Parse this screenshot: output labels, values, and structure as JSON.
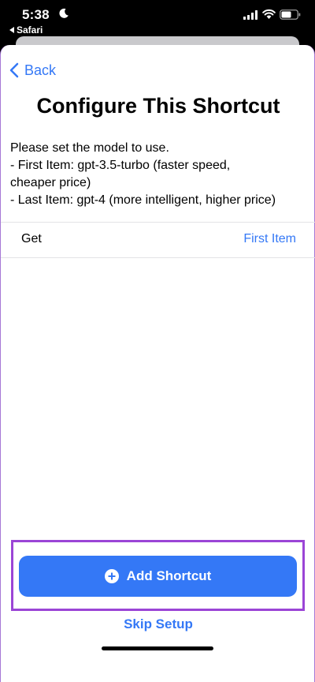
{
  "status": {
    "time": "5:38",
    "back_app": "Safari"
  },
  "nav": {
    "back_label": "Back"
  },
  "page": {
    "title": "Configure This Shortcut",
    "description": [
      "Please set the model to use.",
      "- First Item: gpt-3.5-turbo (faster speed,",
      "cheaper price)",
      "- Last Item: gpt-4 (more intelligent, higher price)"
    ]
  },
  "setting_row": {
    "label": "Get",
    "value": "First Item"
  },
  "actions": {
    "add_label": "Add Shortcut",
    "skip_label": "Skip Setup"
  },
  "colors": {
    "accent": "#3478f6",
    "highlight": "#9b45d6"
  },
  "icons": {
    "moon": "moon-icon",
    "signal": "cellular-signal-icon",
    "wifi": "wifi-icon",
    "battery": "battery-icon",
    "back": "chevron-left-icon",
    "add": "plus-circle-icon"
  }
}
